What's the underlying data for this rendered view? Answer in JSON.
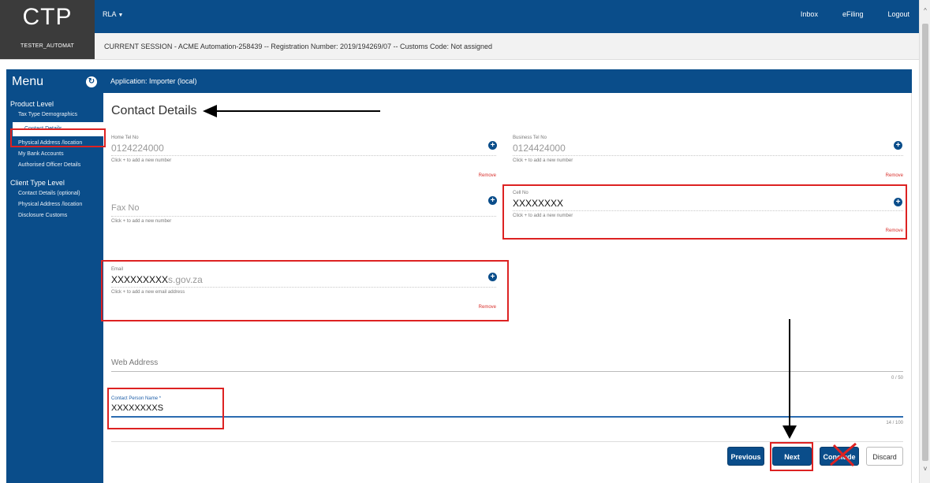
{
  "brand": "CTP",
  "user": "TESTER_AUTOMAT",
  "nav": {
    "dropdown": "RLA",
    "links": [
      "Inbox",
      "eFiling",
      "Logout"
    ]
  },
  "session": "CURRENT SESSION - ACME Automation-258439 -- Registration Number: 2019/194269/07 -- Customs Code: Not assigned",
  "sidebar": {
    "title": "Menu",
    "sections": [
      {
        "title": "Product Level",
        "items": [
          "Tax Type Demographics",
          "Contact Details",
          "Physical Address /location",
          "My Bank Accounts",
          "Authorised Officer Details"
        ]
      },
      {
        "title": "Client Type Level",
        "items": [
          "Contact Details (optional)",
          "Physical Address /location",
          "Disclosure Customs"
        ]
      }
    ]
  },
  "app_header": "Application: Importer (local)",
  "section_title": "Contact Details",
  "fields": {
    "home_tel": {
      "label": "Home Tel No",
      "value": "0124224000",
      "hint": "Click + to add a new number",
      "remove": "Remove"
    },
    "business_tel": {
      "label": "Business Tel No",
      "value": "0124424000",
      "hint": "Click + to add a new number",
      "remove": "Remove"
    },
    "fax": {
      "placeholder": "Fax No",
      "hint": "Click + to add a new number"
    },
    "cell": {
      "label": "Cell No",
      "value": "XXXXXXXX",
      "hint": "Click + to add a new number",
      "remove": "Remove"
    },
    "email": {
      "label": "Email",
      "value_mask": "XXXXXXXXX",
      "value_rest": "s.gov.za",
      "hint": "Click + to add a new email address",
      "remove": "Remove"
    },
    "web": {
      "placeholder": "Web Address",
      "counter": "0 / 50"
    },
    "contact_person": {
      "label": "Contact Person Name *",
      "value": "XXXXXXXXS",
      "counter": "14 / 100"
    }
  },
  "buttons": {
    "previous": "Previous",
    "next": "Next",
    "conclude": "Conclude",
    "discard": "Discard"
  },
  "icons": {
    "add": "plus-circle-icon",
    "refresh": "refresh-icon"
  },
  "colors": {
    "primary": "#0a4d8a",
    "annotation": "#dd2222",
    "remove": "#d9302c"
  }
}
